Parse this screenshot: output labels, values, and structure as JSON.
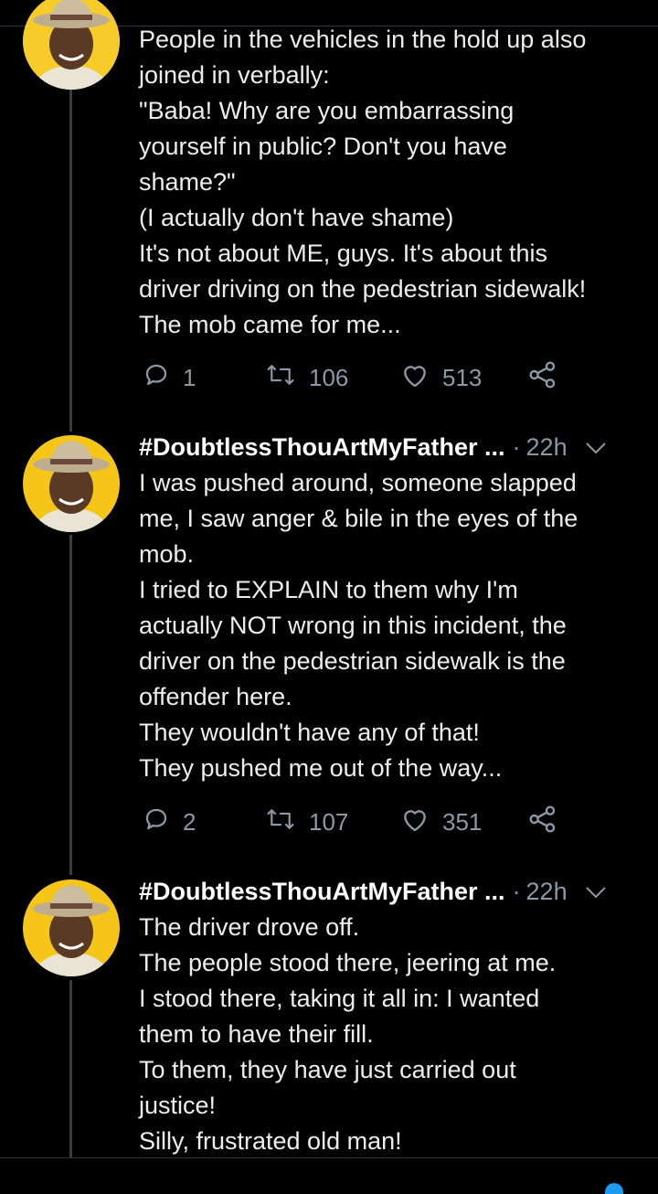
{
  "tweets": [
    {
      "lines": [
        "People in the vehicles in the hold up also",
        "joined in verbally:",
        "\"Baba! Why are you embarrassing",
        "yourself in public? Don't you have",
        "shame?\"",
        "(I actually don't have shame)",
        "It's not about ME, guys. It's about this",
        "driver driving on the pedestrian sidewalk!",
        "The mob came for me..."
      ],
      "replies": "1",
      "retweets": "106",
      "likes": "513"
    },
    {
      "author": "#DoubtlessThouArtMyFather ...",
      "separator": "·",
      "time": "22h",
      "lines": [
        "I was pushed around, someone slapped",
        "me, I saw anger & bile in the eyes of the",
        "mob.",
        "I tried to EXPLAIN to them why I'm",
        "actually NOT wrong in this incident, the",
        "driver on the pedestrian sidewalk is the",
        "offender here.",
        "They wouldn't have any of that!",
        "They pushed me out of the way..."
      ],
      "replies": "2",
      "retweets": "107",
      "likes": "351"
    },
    {
      "author": "#DoubtlessThouArtMyFather ...",
      "separator": "·",
      "time": "22h",
      "lines": [
        "The driver drove off.",
        "The people stood there, jeering at me.",
        "I stood there, taking it all in: I wanted",
        "them to have their fill.",
        "To them, they have just carried out",
        "justice!",
        "Silly, frustrated old man!"
      ]
    }
  ],
  "icons": {
    "reply": "reply-icon",
    "retweet": "retweet-icon",
    "like": "heart-icon",
    "share": "share-icon",
    "more": "chevron-down-icon"
  },
  "colors": {
    "background": "#000000",
    "text": "#ededed",
    "secondary": "#8b98a5",
    "avatar_bg": "#f5c518"
  }
}
